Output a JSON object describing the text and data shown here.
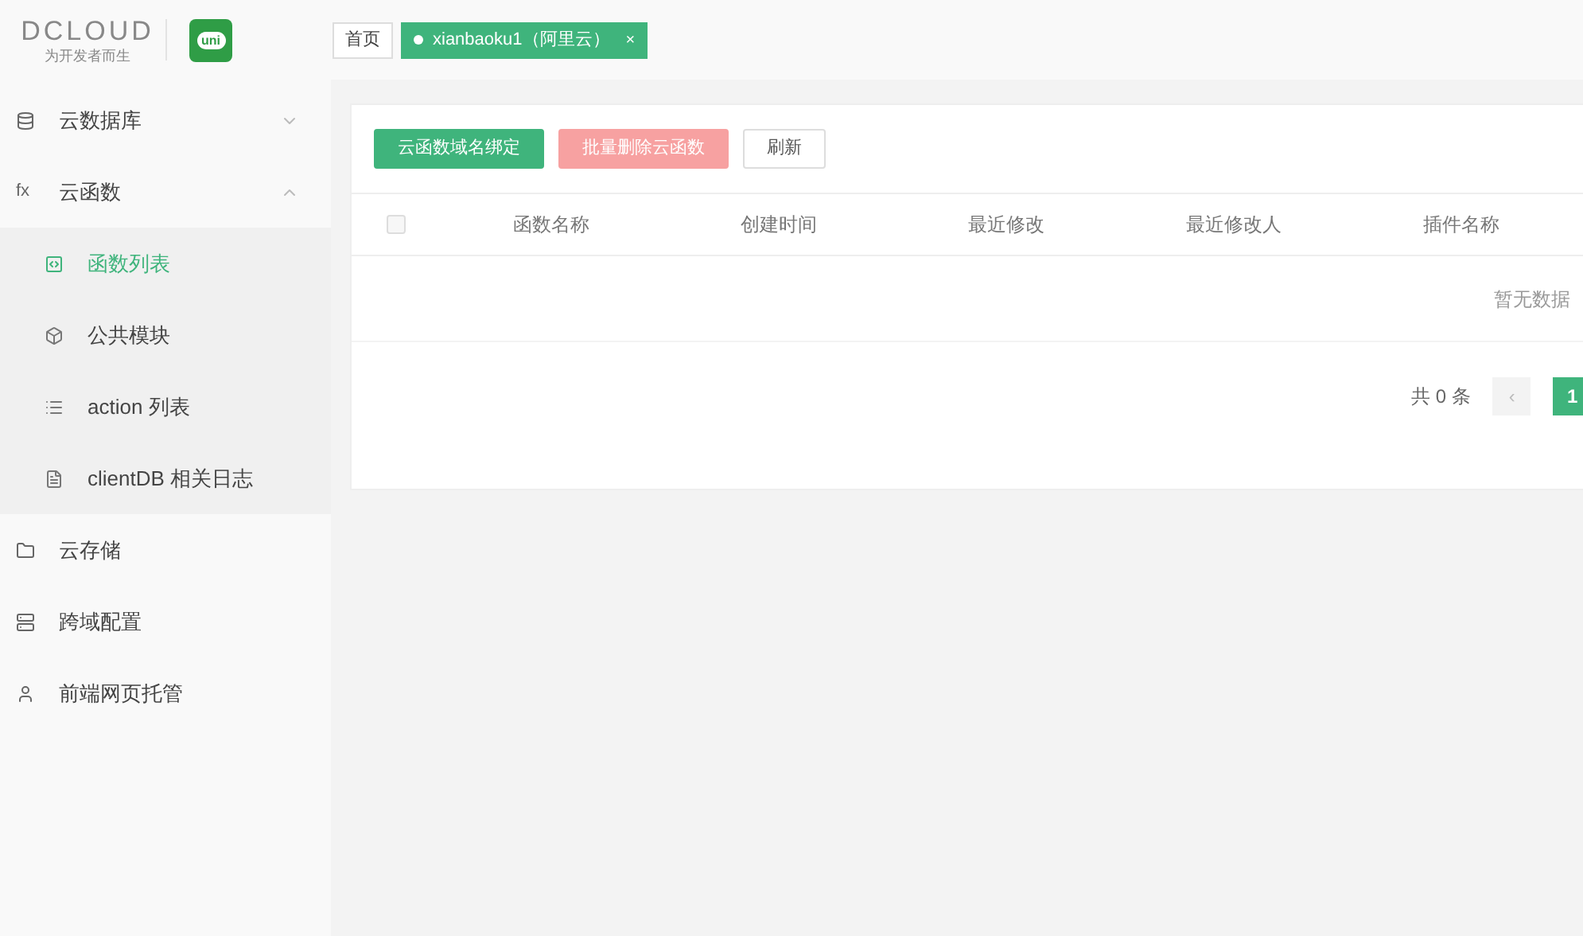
{
  "header": {
    "logo_text": "DCLOUD",
    "logo_slogan": "为开发者而生",
    "app_badge": "uni",
    "tabs": [
      {
        "label": "首页",
        "selected": false
      },
      {
        "label": "xianbaoku1（阿里云）",
        "selected": true,
        "close": "×"
      }
    ]
  },
  "sidebar": {
    "items": [
      {
        "label": "云数据库",
        "expanded": false
      },
      {
        "label": "云函数",
        "icon_text": "fx",
        "expanded": true,
        "children": [
          {
            "label": "函数列表",
            "selected": true
          },
          {
            "label": "公共模块",
            "selected": false
          },
          {
            "label": "action 列表",
            "selected": false
          },
          {
            "label": "clientDB 相关日志",
            "selected": false
          }
        ]
      },
      {
        "label": "云存储"
      },
      {
        "label": "跨域配置"
      },
      {
        "label": "前端网页托管"
      }
    ]
  },
  "toolbar": {
    "buttons": [
      {
        "label": "云函数域名绑定",
        "kind": "primary",
        "disabled": false
      },
      {
        "label": "批量删除云函数",
        "kind": "danger",
        "disabled": true
      },
      {
        "label": "刷新",
        "kind": "default",
        "disabled": false
      }
    ]
  },
  "table": {
    "select_all_checked": false,
    "columns": [
      "函数名称",
      "创建时间",
      "最近修改",
      "最近修改人",
      "插件名称"
    ],
    "empty_text": "暂无数据"
  },
  "pagination": {
    "total": "共 0 条",
    "prev": "‹",
    "pages": [
      {
        "label": "1",
        "selected": true
      }
    ]
  }
}
